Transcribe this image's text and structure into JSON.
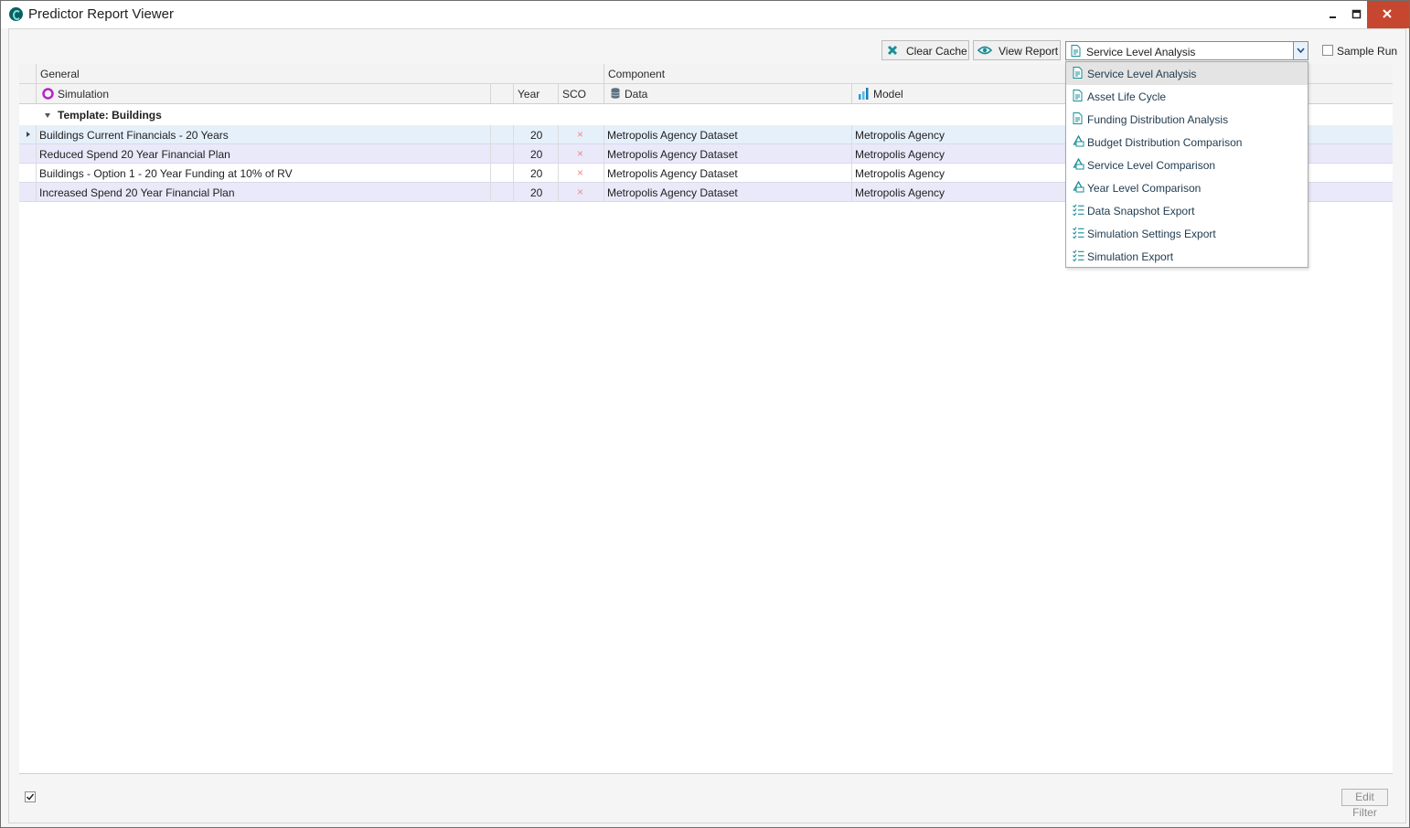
{
  "window": {
    "title": "Predictor Report Viewer",
    "controls": {
      "minimize": "–",
      "maximize": "□"
    }
  },
  "toolbar": {
    "clear_cache_label": "Clear Cache",
    "view_report_label": "View Report",
    "report_select": "Service Level Analysis",
    "sample_run_label": "Sample Run",
    "sample_run_checked": false
  },
  "grid": {
    "bands": {
      "general": "General",
      "component": "Component"
    },
    "columns": {
      "simulation": "Simulation",
      "year": "Year",
      "sco": "SCO",
      "data": "Data",
      "model": "Model"
    },
    "group_label": "Template: Buildings",
    "rows": [
      {
        "simulation": "Buildings Current Financials - 20 Years",
        "year": "20",
        "sco": "×",
        "data": "Metropolis Agency Dataset",
        "model": "Metropolis Agency"
      },
      {
        "simulation": "Reduced Spend 20 Year Financial Plan",
        "year": "20",
        "sco": "×",
        "data": "Metropolis Agency Dataset",
        "model": "Metropolis Agency"
      },
      {
        "simulation": "Buildings - Option 1 - 20 Year Funding at 10% of RV",
        "year": "20",
        "sco": "×",
        "data": "Metropolis Agency Dataset",
        "model": "Metropolis Agency"
      },
      {
        "simulation": "Increased Spend 20 Year Financial Plan",
        "year": "20",
        "sco": "×",
        "data": "Metropolis Agency Dataset",
        "model": "Metropolis Agency"
      }
    ]
  },
  "dropdown": {
    "items": [
      {
        "label": "Service Level Analysis",
        "icon": "report-doc-icon"
      },
      {
        "label": "Asset Life Cycle",
        "icon": "report-doc-icon"
      },
      {
        "label": "Funding Distribution Analysis",
        "icon": "report-doc-icon"
      },
      {
        "label": "Budget Distribution Comparison",
        "icon": "comparison-icon"
      },
      {
        "label": "Service Level Comparison",
        "icon": "comparison-icon"
      },
      {
        "label": "Year Level Comparison",
        "icon": "comparison-icon"
      },
      {
        "label": "Data Snapshot Export",
        "icon": "checklist-icon"
      },
      {
        "label": "Simulation Settings Export",
        "icon": "checklist-icon"
      },
      {
        "label": "Simulation Export",
        "icon": "checklist-icon"
      }
    ]
  },
  "footer": {
    "edit_filter_label": "Edit Filter",
    "checkbox_checked": true
  },
  "colors": {
    "accent_teal": "#1a8f97",
    "row_alt": "#e9e9fa",
    "row_selected": "#e6f0fb",
    "sco_x": "#f08a8a",
    "simulation_icon": "#b624c8"
  }
}
